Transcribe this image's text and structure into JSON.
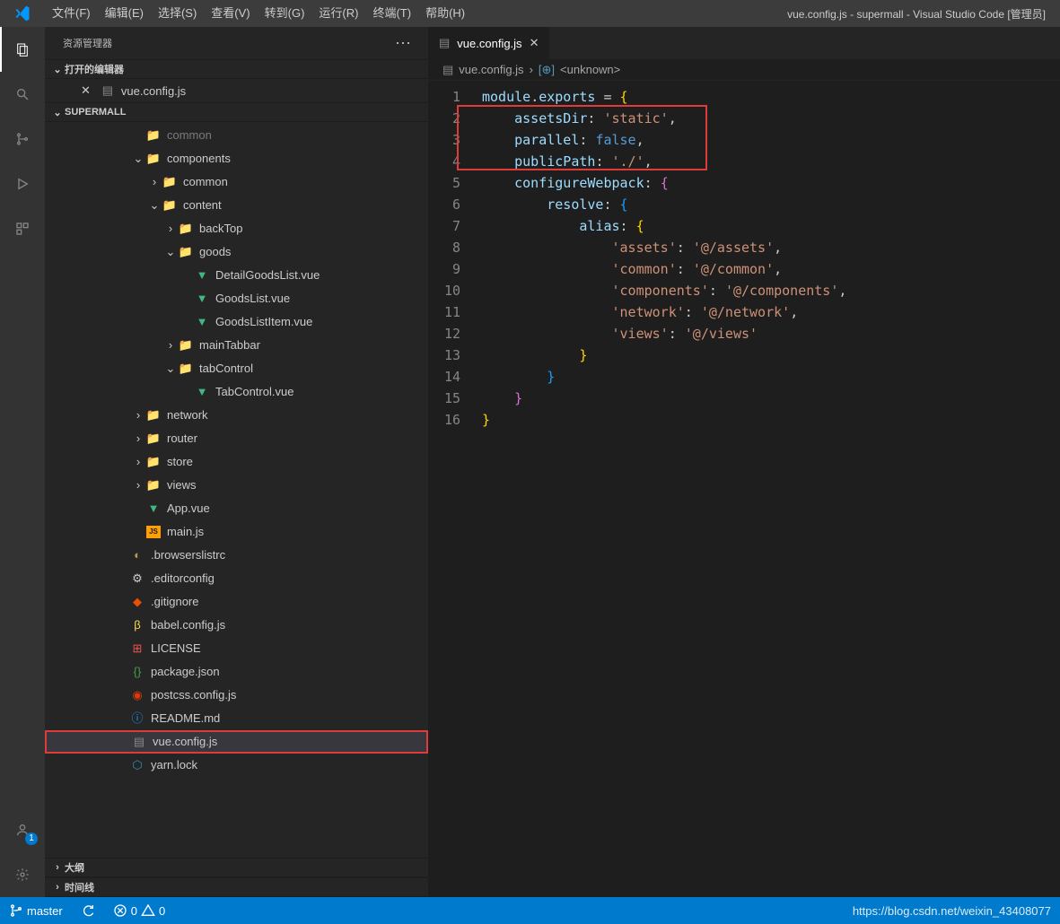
{
  "titlebar": {
    "title": "vue.config.js - supermall - Visual Studio Code [管理员]",
    "menu": [
      "文件(F)",
      "编辑(E)",
      "选择(S)",
      "查看(V)",
      "转到(G)",
      "运行(R)",
      "终端(T)",
      "帮助(H)"
    ]
  },
  "sidebar": {
    "title": "资源管理器",
    "openEditorsLabel": "打开的编辑器",
    "openEditorFile": "vue.config.js",
    "projectName": "SUPERMALL",
    "outline": "大纲",
    "timeline": "时间线"
  },
  "tree": {
    "items": [
      {
        "depth": 0,
        "chev": "",
        "icon": "folder-green",
        "label": "common",
        "dim": true
      },
      {
        "depth": 0,
        "chev": "v",
        "icon": "folder-green",
        "label": "components"
      },
      {
        "depth": 1,
        "chev": ">",
        "icon": "folder-yellow",
        "label": "common"
      },
      {
        "depth": 1,
        "chev": "v",
        "icon": "folder-cyan",
        "label": "content"
      },
      {
        "depth": 2,
        "chev": ">",
        "icon": "folder-plain",
        "label": "backTop"
      },
      {
        "depth": 2,
        "chev": "v",
        "icon": "folder-plain",
        "label": "goods"
      },
      {
        "depth": 3,
        "chev": "",
        "icon": "vue",
        "label": "DetailGoodsList.vue"
      },
      {
        "depth": 3,
        "chev": "",
        "icon": "vue",
        "label": "GoodsList.vue"
      },
      {
        "depth": 3,
        "chev": "",
        "icon": "vue",
        "label": "GoodsListItem.vue"
      },
      {
        "depth": 2,
        "chev": ">",
        "icon": "folder-plain",
        "label": "mainTabbar"
      },
      {
        "depth": 2,
        "chev": "v",
        "icon": "folder-plain",
        "label": "tabControl"
      },
      {
        "depth": 3,
        "chev": "",
        "icon": "vue",
        "label": "TabControl.vue"
      },
      {
        "depth": 0,
        "chev": ">",
        "icon": "folder-plain",
        "label": "network"
      },
      {
        "depth": 0,
        "chev": ">",
        "icon": "folder-green",
        "label": "router"
      },
      {
        "depth": 0,
        "chev": ">",
        "icon": "folder-plain",
        "label": "store"
      },
      {
        "depth": 0,
        "chev": ">",
        "icon": "folder-orange",
        "label": "views"
      },
      {
        "depth": 0,
        "chev": "",
        "icon": "vue",
        "label": "App.vue"
      },
      {
        "depth": 0,
        "chev": "",
        "icon": "js",
        "label": "main.js"
      },
      {
        "depth": -1,
        "chev": "",
        "icon": "misc",
        "label": ".browserslistrc"
      },
      {
        "depth": -1,
        "chev": "",
        "icon": "gear",
        "label": ".editorconfig"
      },
      {
        "depth": -1,
        "chev": "",
        "icon": "git",
        "label": ".gitignore"
      },
      {
        "depth": -1,
        "chev": "",
        "icon": "babel",
        "label": "babel.config.js"
      },
      {
        "depth": -1,
        "chev": "",
        "icon": "license",
        "label": "LICENSE"
      },
      {
        "depth": -1,
        "chev": "",
        "icon": "json",
        "label": "package.json"
      },
      {
        "depth": -1,
        "chev": "",
        "icon": "postcss",
        "label": "postcss.config.js"
      },
      {
        "depth": -1,
        "chev": "",
        "icon": "md",
        "label": "README.md"
      },
      {
        "depth": -1,
        "chev": "",
        "icon": "gray",
        "label": "vue.config.js",
        "selected": true,
        "redbox": true
      },
      {
        "depth": -1,
        "chev": "",
        "icon": "yarn",
        "label": "yarn.lock"
      }
    ]
  },
  "tab": {
    "label": "vue.config.js"
  },
  "breadcrumb": {
    "file": "vue.config.js",
    "symbol": "<unknown>"
  },
  "code": {
    "lines": 16,
    "content": [
      [
        {
          "t": "module",
          "c": "prop"
        },
        {
          "t": ".",
          "c": "punc"
        },
        {
          "t": "exports",
          "c": "prop"
        },
        {
          "t": " = ",
          "c": "punc"
        },
        {
          "t": "{",
          "c": "brace"
        }
      ],
      [
        {
          "t": "    ",
          "c": "punc"
        },
        {
          "t": "assetsDir",
          "c": "prop"
        },
        {
          "t": ": ",
          "c": "punc"
        },
        {
          "t": "'static'",
          "c": "str"
        },
        {
          "t": ",",
          "c": "punc"
        }
      ],
      [
        {
          "t": "    ",
          "c": "punc"
        },
        {
          "t": "parallel",
          "c": "prop"
        },
        {
          "t": ": ",
          "c": "punc"
        },
        {
          "t": "false",
          "c": "kw"
        },
        {
          "t": ",",
          "c": "punc"
        }
      ],
      [
        {
          "t": "    ",
          "c": "punc"
        },
        {
          "t": "publicPath",
          "c": "prop"
        },
        {
          "t": ": ",
          "c": "punc"
        },
        {
          "t": "'./'",
          "c": "str"
        },
        {
          "t": ",",
          "c": "punc"
        }
      ],
      [
        {
          "t": "    ",
          "c": "punc"
        },
        {
          "t": "configureWebpack",
          "c": "prop"
        },
        {
          "t": ": ",
          "c": "punc"
        },
        {
          "t": "{",
          "c": "brace2"
        }
      ],
      [
        {
          "t": "        ",
          "c": "punc"
        },
        {
          "t": "resolve",
          "c": "prop"
        },
        {
          "t": ": ",
          "c": "punc"
        },
        {
          "t": "{",
          "c": "brace3"
        }
      ],
      [
        {
          "t": "            ",
          "c": "punc"
        },
        {
          "t": "alias",
          "c": "prop"
        },
        {
          "t": ": ",
          "c": "punc"
        },
        {
          "t": "{",
          "c": "brace"
        }
      ],
      [
        {
          "t": "                ",
          "c": "punc"
        },
        {
          "t": "'assets'",
          "c": "str"
        },
        {
          "t": ": ",
          "c": "punc"
        },
        {
          "t": "'@/assets'",
          "c": "str"
        },
        {
          "t": ",",
          "c": "punc"
        }
      ],
      [
        {
          "t": "                ",
          "c": "punc"
        },
        {
          "t": "'common'",
          "c": "str"
        },
        {
          "t": ": ",
          "c": "punc"
        },
        {
          "t": "'@/common'",
          "c": "str"
        },
        {
          "t": ",",
          "c": "punc"
        }
      ],
      [
        {
          "t": "                ",
          "c": "punc"
        },
        {
          "t": "'components'",
          "c": "str"
        },
        {
          "t": ": ",
          "c": "punc"
        },
        {
          "t": "'@/components'",
          "c": "str"
        },
        {
          "t": ",",
          "c": "punc"
        }
      ],
      [
        {
          "t": "                ",
          "c": "punc"
        },
        {
          "t": "'network'",
          "c": "str"
        },
        {
          "t": ": ",
          "c": "punc"
        },
        {
          "t": "'@/network'",
          "c": "str"
        },
        {
          "t": ",",
          "c": "punc"
        }
      ],
      [
        {
          "t": "                ",
          "c": "punc"
        },
        {
          "t": "'views'",
          "c": "str"
        },
        {
          "t": ": ",
          "c": "punc"
        },
        {
          "t": "'@/views'",
          "c": "str"
        }
      ],
      [
        {
          "t": "            ",
          "c": "punc"
        },
        {
          "t": "}",
          "c": "brace"
        }
      ],
      [
        {
          "t": "        ",
          "c": "punc"
        },
        {
          "t": "}",
          "c": "brace3"
        }
      ],
      [
        {
          "t": "    ",
          "c": "punc"
        },
        {
          "t": "}",
          "c": "brace2"
        }
      ],
      [
        {
          "t": "}",
          "c": "brace"
        }
      ]
    ]
  },
  "statusbar": {
    "branch": "master",
    "errors": "0",
    "warnings": "0",
    "watermark": "https://blog.csdn.net/weixin_43408077"
  },
  "accountBadge": "1"
}
